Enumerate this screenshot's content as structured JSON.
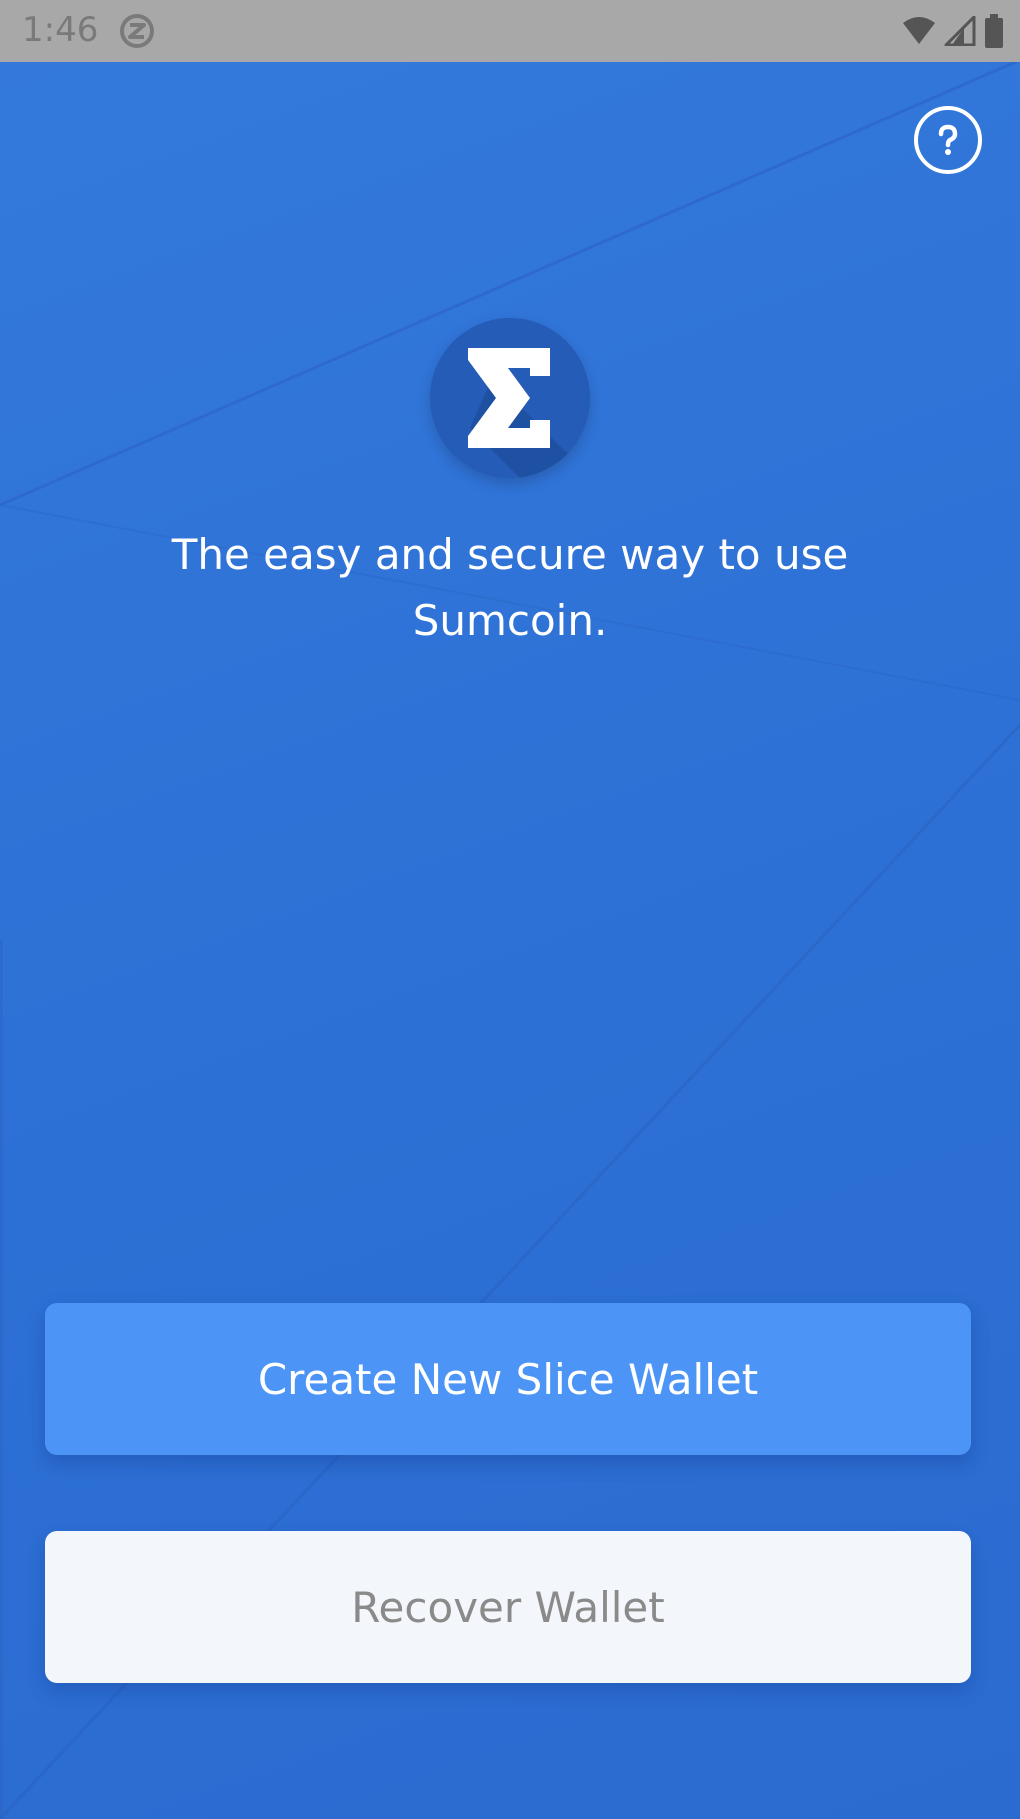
{
  "status_bar": {
    "time": "1:46",
    "icons": [
      "app-notification-icon",
      "wifi-icon",
      "signal-icon",
      "battery-icon"
    ]
  },
  "header": {
    "help_icon": "help-circle-icon"
  },
  "branding": {
    "logo_icon": "sigma-logo-icon",
    "logo_glyph": "Σ",
    "tagline": "The easy and secure way to use Sumcoin."
  },
  "actions": {
    "create_label": "Create New Slice Wallet",
    "recover_label": "Recover Wallet"
  },
  "colors": {
    "background": "#2f72d6",
    "primary_button": "#4c95f7",
    "secondary_button": "#f3f6fa",
    "secondary_text": "#8a8a8a",
    "status_bar": "#a8a8a8"
  }
}
